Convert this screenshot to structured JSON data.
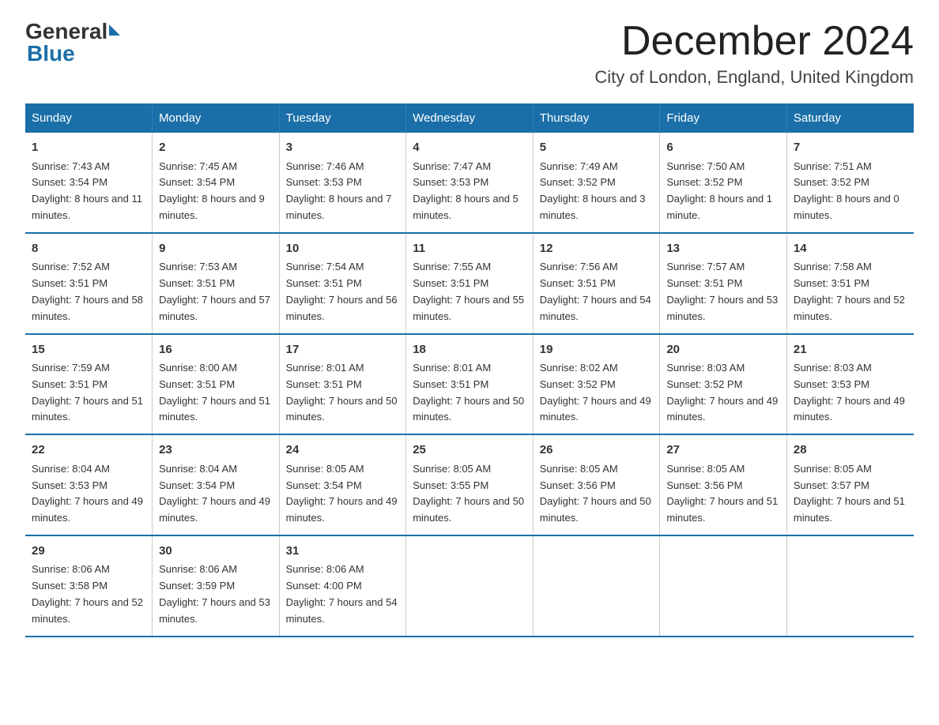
{
  "logo": {
    "general": "General",
    "blue": "Blue"
  },
  "title": "December 2024",
  "subtitle": "City of London, England, United Kingdom",
  "days_of_week": [
    "Sunday",
    "Monday",
    "Tuesday",
    "Wednesday",
    "Thursday",
    "Friday",
    "Saturday"
  ],
  "weeks": [
    [
      {
        "day": "1",
        "sunrise": "7:43 AM",
        "sunset": "3:54 PM",
        "daylight": "8 hours and 11 minutes."
      },
      {
        "day": "2",
        "sunrise": "7:45 AM",
        "sunset": "3:54 PM",
        "daylight": "8 hours and 9 minutes."
      },
      {
        "day": "3",
        "sunrise": "7:46 AM",
        "sunset": "3:53 PM",
        "daylight": "8 hours and 7 minutes."
      },
      {
        "day": "4",
        "sunrise": "7:47 AM",
        "sunset": "3:53 PM",
        "daylight": "8 hours and 5 minutes."
      },
      {
        "day": "5",
        "sunrise": "7:49 AM",
        "sunset": "3:52 PM",
        "daylight": "8 hours and 3 minutes."
      },
      {
        "day": "6",
        "sunrise": "7:50 AM",
        "sunset": "3:52 PM",
        "daylight": "8 hours and 1 minute."
      },
      {
        "day": "7",
        "sunrise": "7:51 AM",
        "sunset": "3:52 PM",
        "daylight": "8 hours and 0 minutes."
      }
    ],
    [
      {
        "day": "8",
        "sunrise": "7:52 AM",
        "sunset": "3:51 PM",
        "daylight": "7 hours and 58 minutes."
      },
      {
        "day": "9",
        "sunrise": "7:53 AM",
        "sunset": "3:51 PM",
        "daylight": "7 hours and 57 minutes."
      },
      {
        "day": "10",
        "sunrise": "7:54 AM",
        "sunset": "3:51 PM",
        "daylight": "7 hours and 56 minutes."
      },
      {
        "day": "11",
        "sunrise": "7:55 AM",
        "sunset": "3:51 PM",
        "daylight": "7 hours and 55 minutes."
      },
      {
        "day": "12",
        "sunrise": "7:56 AM",
        "sunset": "3:51 PM",
        "daylight": "7 hours and 54 minutes."
      },
      {
        "day": "13",
        "sunrise": "7:57 AM",
        "sunset": "3:51 PM",
        "daylight": "7 hours and 53 minutes."
      },
      {
        "day": "14",
        "sunrise": "7:58 AM",
        "sunset": "3:51 PM",
        "daylight": "7 hours and 52 minutes."
      }
    ],
    [
      {
        "day": "15",
        "sunrise": "7:59 AM",
        "sunset": "3:51 PM",
        "daylight": "7 hours and 51 minutes."
      },
      {
        "day": "16",
        "sunrise": "8:00 AM",
        "sunset": "3:51 PM",
        "daylight": "7 hours and 51 minutes."
      },
      {
        "day": "17",
        "sunrise": "8:01 AM",
        "sunset": "3:51 PM",
        "daylight": "7 hours and 50 minutes."
      },
      {
        "day": "18",
        "sunrise": "8:01 AM",
        "sunset": "3:51 PM",
        "daylight": "7 hours and 50 minutes."
      },
      {
        "day": "19",
        "sunrise": "8:02 AM",
        "sunset": "3:52 PM",
        "daylight": "7 hours and 49 minutes."
      },
      {
        "day": "20",
        "sunrise": "8:03 AM",
        "sunset": "3:52 PM",
        "daylight": "7 hours and 49 minutes."
      },
      {
        "day": "21",
        "sunrise": "8:03 AM",
        "sunset": "3:53 PM",
        "daylight": "7 hours and 49 minutes."
      }
    ],
    [
      {
        "day": "22",
        "sunrise": "8:04 AM",
        "sunset": "3:53 PM",
        "daylight": "7 hours and 49 minutes."
      },
      {
        "day": "23",
        "sunrise": "8:04 AM",
        "sunset": "3:54 PM",
        "daylight": "7 hours and 49 minutes."
      },
      {
        "day": "24",
        "sunrise": "8:05 AM",
        "sunset": "3:54 PM",
        "daylight": "7 hours and 49 minutes."
      },
      {
        "day": "25",
        "sunrise": "8:05 AM",
        "sunset": "3:55 PM",
        "daylight": "7 hours and 50 minutes."
      },
      {
        "day": "26",
        "sunrise": "8:05 AM",
        "sunset": "3:56 PM",
        "daylight": "7 hours and 50 minutes."
      },
      {
        "day": "27",
        "sunrise": "8:05 AM",
        "sunset": "3:56 PM",
        "daylight": "7 hours and 51 minutes."
      },
      {
        "day": "28",
        "sunrise": "8:05 AM",
        "sunset": "3:57 PM",
        "daylight": "7 hours and 51 minutes."
      }
    ],
    [
      {
        "day": "29",
        "sunrise": "8:06 AM",
        "sunset": "3:58 PM",
        "daylight": "7 hours and 52 minutes."
      },
      {
        "day": "30",
        "sunrise": "8:06 AM",
        "sunset": "3:59 PM",
        "daylight": "7 hours and 53 minutes."
      },
      {
        "day": "31",
        "sunrise": "8:06 AM",
        "sunset": "4:00 PM",
        "daylight": "7 hours and 54 minutes."
      },
      null,
      null,
      null,
      null
    ]
  ],
  "labels": {
    "sunrise_prefix": "Sunrise: ",
    "sunset_prefix": "Sunset: ",
    "daylight_prefix": "Daylight: "
  }
}
